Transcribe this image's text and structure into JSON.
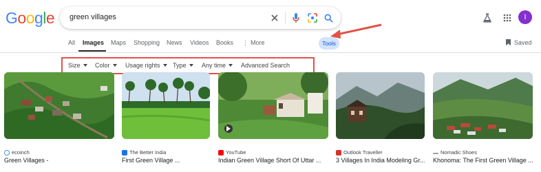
{
  "logo": {
    "letters": [
      "G",
      "o",
      "o",
      "g",
      "l",
      "e"
    ],
    "colors": [
      "#4285f4",
      "#ea4335",
      "#fbbc05",
      "#4285f4",
      "#34a853",
      "#ea4335"
    ]
  },
  "search": {
    "query": "green villages"
  },
  "account": {
    "avatar_letter": "I",
    "avatar_color": "#8430ce"
  },
  "tabs": [
    {
      "label": "All"
    },
    {
      "label": "Images"
    },
    {
      "label": "Maps"
    },
    {
      "label": "Shopping"
    },
    {
      "label": "News"
    },
    {
      "label": "Videos"
    },
    {
      "label": "Books"
    },
    {
      "label": "More"
    }
  ],
  "active_tab": "Images",
  "tools_label": "Tools",
  "saved_label": "Saved",
  "filters": [
    {
      "label": "Size"
    },
    {
      "label": "Color"
    },
    {
      "label": "Usage rights"
    },
    {
      "label": "Type"
    },
    {
      "label": "Any time"
    }
  ],
  "advanced_search_label": "Advanced Search",
  "highlight_color": "#e0524b",
  "results": [
    {
      "source": "ecoinch",
      "title": "Green Villages -",
      "favicon_color": "#4a90d9"
    },
    {
      "source": "The Better India",
      "title": "First Green Village ...",
      "favicon_color": "#1a73e8"
    },
    {
      "source": "YouTube",
      "title": "Indian Green Village Short Of Uttar ...",
      "favicon_color": "#ff0000"
    },
    {
      "source": "Outlook Traveller",
      "title": "3 Villages In India Modeling Gr...",
      "favicon_color": "#d93025"
    },
    {
      "source": "Nomadic Shoes",
      "title": "Khonoma: The First Green Village ...",
      "favicon_color": "#9aa0a6"
    }
  ]
}
